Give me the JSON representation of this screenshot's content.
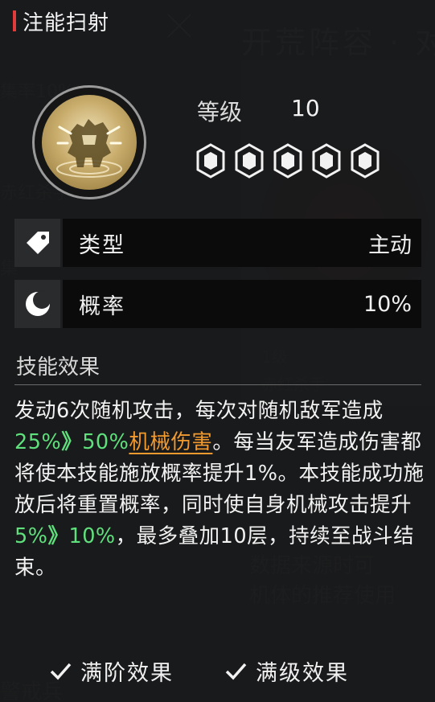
{
  "title": "注能扫射",
  "level": {
    "label": "等级",
    "value": "10"
  },
  "stars": {
    "filled": 5,
    "total": 5
  },
  "stats": [
    {
      "icon": "tag-icon",
      "label": "类型",
      "value": "主动"
    },
    {
      "icon": "crescent-moon-icon",
      "label": "概率",
      "value": "10%"
    }
  ],
  "effect": {
    "heading": "技能效果",
    "seg1": "发动6次随机攻击，每次对随机敌军造成",
    "v1_from": "25%",
    "arrow": "》",
    "v1_to": "50%",
    "dmg_type": "机械伤害",
    "seg2": "。每当友军造成伤害都将使本技能施放概率提升1%。本技能成功施放后将重置概率，同时使自身机械攻击提升",
    "v2_from": "5%",
    "v2_to": "10%",
    "seg3": "，最多叠加10层，持续至战斗结束。"
  },
  "toggles": [
    {
      "label": "满阶效果",
      "checked": true
    },
    {
      "label": "满级效果",
      "checked": true
    }
  ],
  "colors": {
    "accent_red": "#e23b3b",
    "highlight_green": "#5fe07c",
    "highlight_orange": "#f29a2e"
  }
}
